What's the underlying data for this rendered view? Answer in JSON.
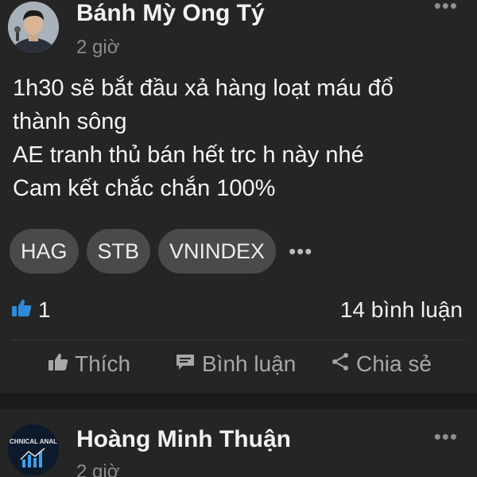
{
  "posts": [
    {
      "author": "Bánh Mỳ Ong Tý",
      "time": "2 giờ",
      "more": "•••",
      "content_lines": [
        "1h30 sẽ bắt đầu xả hàng loạt máu đổ",
        "thành sông",
        "AE tranh thủ bán hết trc h này nhé",
        "Cam kết chắc chắn 100%"
      ],
      "tags": [
        "HAG",
        "STB",
        "VNINDEX"
      ],
      "tags_more": "•••",
      "like_count": "1",
      "comment_count": "14 bình luận",
      "actions": {
        "like": "Thích",
        "comment": "Bình luận",
        "share": "Chia sẻ"
      }
    },
    {
      "author": "Hoàng Minh Thuận",
      "time": "2 giờ",
      "more": "•••",
      "avatar_text": "CHNICAL ANAL"
    }
  ],
  "colors": {
    "background": "#1a1a1a",
    "card": "#252526",
    "tag": "#4a4a4c",
    "like_icon": "#2f8bd8",
    "muted": "#a7a7a9"
  },
  "icons": [
    "thumbs-up-icon",
    "comment-icon",
    "share-icon",
    "more-icon"
  ]
}
